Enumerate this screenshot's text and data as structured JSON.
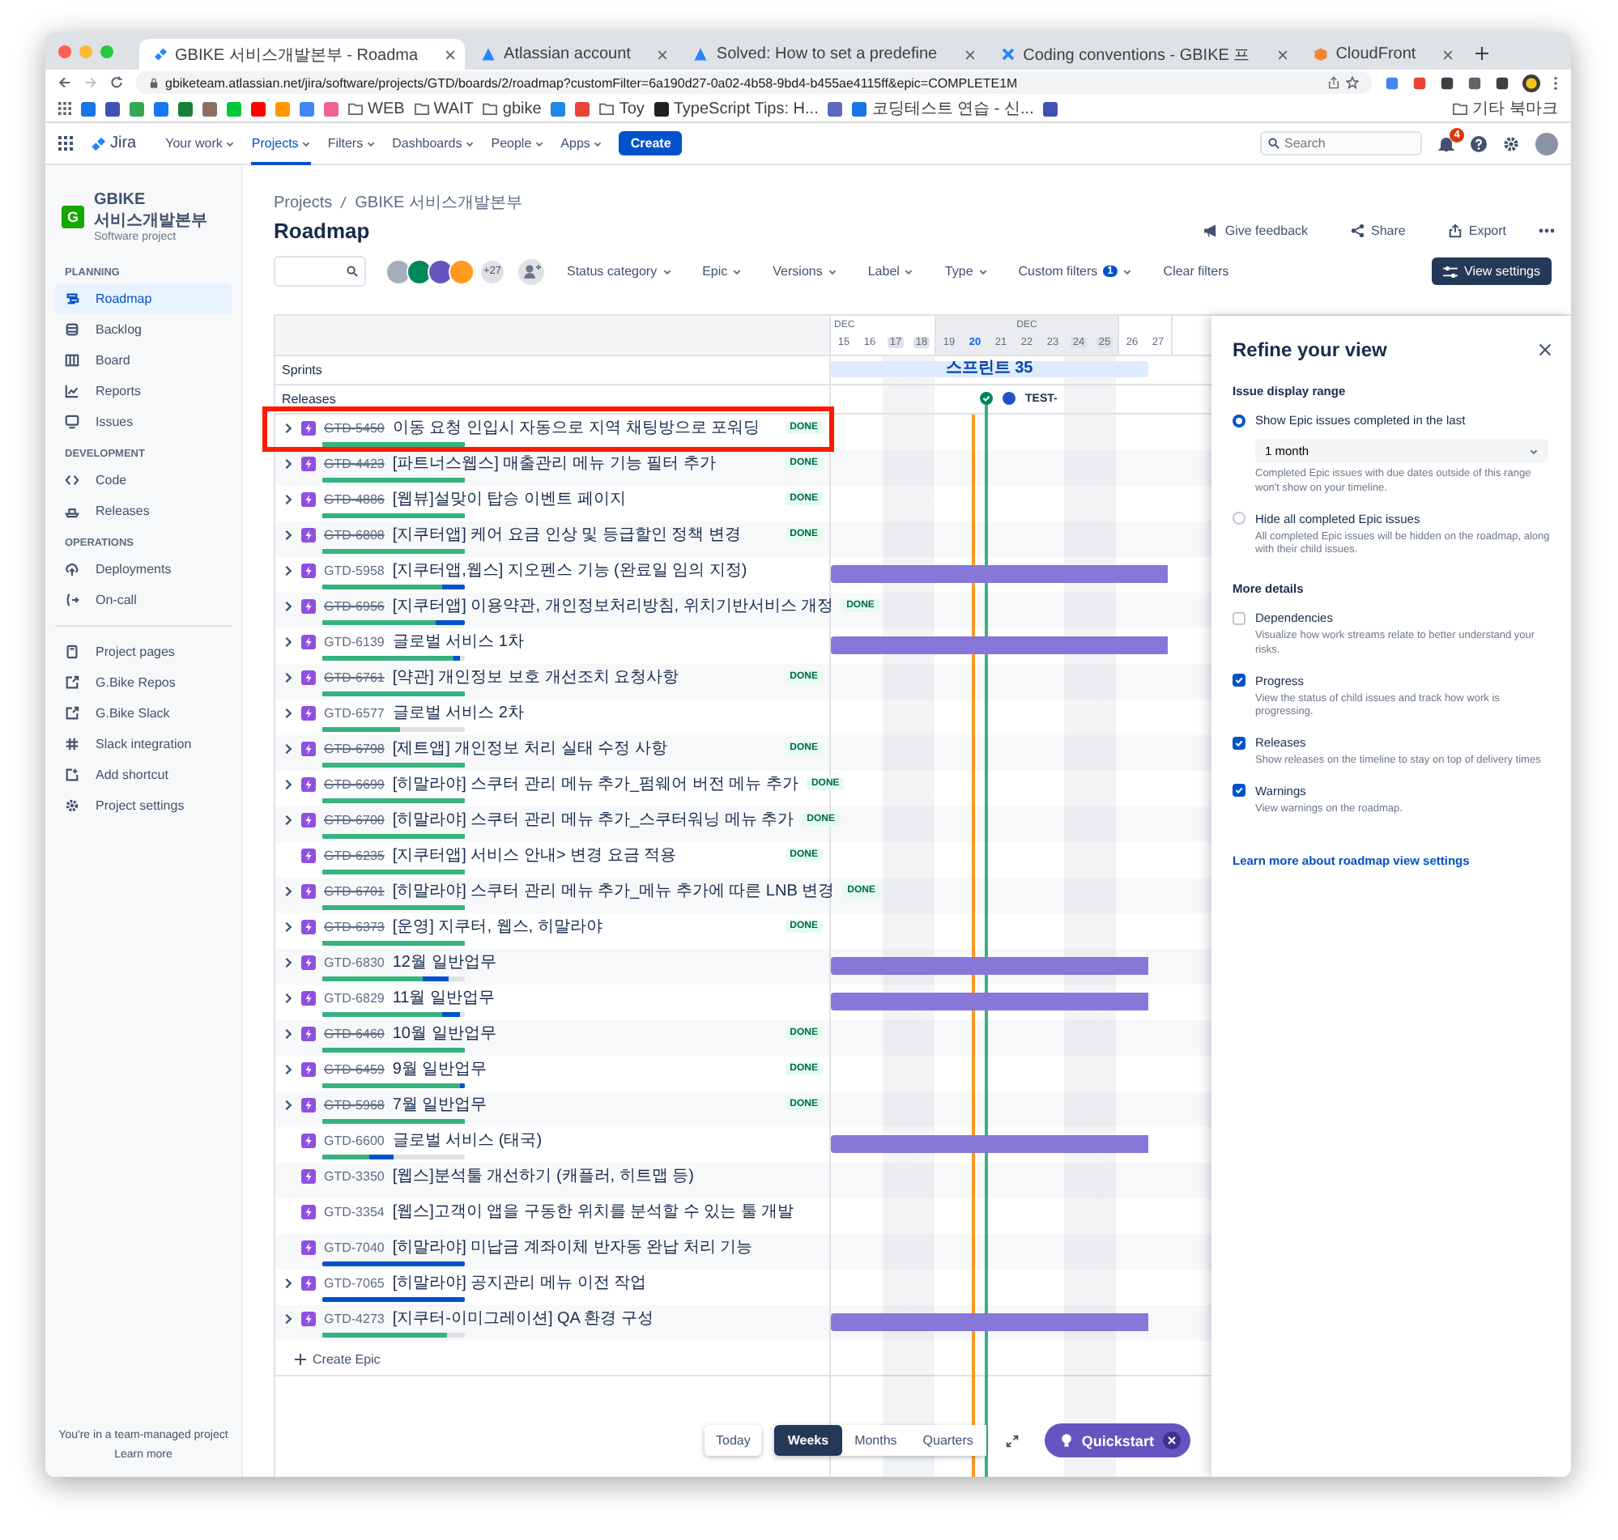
{
  "browser": {
    "tabs": [
      {
        "title": "GBIKE 서비스개발본부 - Roadma",
        "kind": "jira",
        "selected": true
      },
      {
        "title": "Atlassian account",
        "kind": "atlassian",
        "selected": false
      },
      {
        "title": "Solved: How to set a predefine",
        "kind": "atlassian",
        "selected": false
      },
      {
        "title": "Coding conventions - GBIKE 프",
        "kind": "confluence",
        "selected": false
      },
      {
        "title": "CloudFront",
        "kind": "cube",
        "selected": false
      }
    ],
    "address": "gbiketeam.atlassian.net/jira/software/projects/GTD/boards/2/roadmap?customFilter=6a190d27-0a02-4b58-9bd4-b455ae4115ff&epic=COMPLETE1M",
    "bookmarks": [
      {
        "kind": "icon"
      },
      {
        "kind": "icon"
      },
      {
        "kind": "icon"
      },
      {
        "kind": "icon"
      },
      {
        "kind": "icon"
      },
      {
        "kind": "icon"
      },
      {
        "kind": "icon"
      },
      {
        "kind": "icon"
      },
      {
        "kind": "icon"
      },
      {
        "kind": "icon"
      },
      {
        "kind": "icon"
      },
      {
        "kind": "folder",
        "label": "WEB"
      },
      {
        "kind": "folder",
        "label": "WAIT"
      },
      {
        "kind": "folder",
        "label": "gbike"
      },
      {
        "kind": "icon"
      },
      {
        "kind": "icon"
      },
      {
        "kind": "folder",
        "label": "Toy"
      },
      {
        "kind": "link",
        "label": "TypeScript Tips: H..."
      },
      {
        "kind": "icon"
      },
      {
        "kind": "link",
        "label": "코딩테스트 연습 - 신..."
      },
      {
        "kind": "icon"
      }
    ],
    "other_bookmarks": "기타 북마크"
  },
  "topnav": {
    "product": "Jira",
    "items": [
      {
        "label": "Your work",
        "selected": false
      },
      {
        "label": "Projects",
        "selected": true
      },
      {
        "label": "Filters",
        "selected": false
      },
      {
        "label": "Dashboards",
        "selected": false
      },
      {
        "label": "People",
        "selected": false
      },
      {
        "label": "Apps",
        "selected": false
      }
    ],
    "create": "Create",
    "search": {
      "placeholder": "Search"
    },
    "notifications": {
      "count": "4"
    }
  },
  "sidebar": {
    "project": {
      "logo_letter": "G",
      "name": "GBIKE 서비스개발본부",
      "type": "Software project"
    },
    "sections": [
      {
        "heading": "PLANNING",
        "items": [
          {
            "label": "Roadmap",
            "selected": true
          },
          {
            "label": "Backlog",
            "selected": false
          },
          {
            "label": "Board",
            "selected": false
          },
          {
            "label": "Reports",
            "selected": false
          },
          {
            "label": "Issues",
            "selected": false
          }
        ]
      },
      {
        "heading": "DEVELOPMENT",
        "items": [
          {
            "label": "Code",
            "selected": false
          },
          {
            "label": "Releases",
            "selected": false
          }
        ]
      },
      {
        "heading": "OPERATIONS",
        "items": [
          {
            "label": "Deployments",
            "selected": false
          },
          {
            "label": "On-call",
            "selected": false
          }
        ]
      },
      {
        "items": [
          {
            "label": "Project pages",
            "selected": false
          },
          {
            "label": "G.Bike Repos",
            "selected": false
          },
          {
            "label": "G.Bike Slack",
            "selected": false
          },
          {
            "label": "Slack integration",
            "selected": false
          },
          {
            "label": "Add shortcut",
            "selected": false
          },
          {
            "label": "Project settings",
            "selected": false
          }
        ]
      }
    ],
    "footer": {
      "text": "You're in a team-managed project",
      "link": "Learn more"
    }
  },
  "page": {
    "breadcrumbs": [
      "Projects",
      "GBIKE 서비스개발본부"
    ],
    "title": "Roadmap",
    "actions": [
      "Give feedback",
      "Share",
      "Export"
    ]
  },
  "filters": {
    "more_people": "+27",
    "dropdowns": [
      {
        "label": "Status category"
      },
      {
        "label": "Epic"
      },
      {
        "label": "Versions"
      },
      {
        "label": "Label"
      },
      {
        "label": "Type"
      },
      {
        "label": "Custom filters",
        "count": "1"
      }
    ],
    "clear": "Clear filters",
    "view_settings": "View settings"
  },
  "timeline": {
    "weeks": [
      {
        "month": "DEC",
        "current": false,
        "days": [
          {
            "label": "15",
            "weekend": false,
            "today": false
          },
          {
            "label": "16",
            "weekend": false,
            "today": false
          },
          {
            "label": "17",
            "weekend": true,
            "today": false
          },
          {
            "label": "18",
            "weekend": true,
            "today": false
          }
        ]
      },
      {
        "month": "DEC",
        "current": true,
        "days": [
          {
            "label": "19",
            "weekend": false,
            "today": false
          },
          {
            "label": "20",
            "weekend": false,
            "today": true,
            "release": {
              "name": "TEST-"
            }
          },
          {
            "label": "21",
            "weekend": false,
            "today": false
          },
          {
            "label": "22",
            "weekend": false,
            "today": false
          },
          {
            "label": "23",
            "weekend": false,
            "today": false
          },
          {
            "label": "24",
            "weekend": true,
            "today": false
          },
          {
            "label": "25",
            "weekend": true,
            "today": false
          }
        ]
      },
      {
        "current": false,
        "days": [
          {
            "label": "26",
            "weekend": false,
            "today": false
          },
          {
            "label": "27",
            "weekend": false,
            "today": false
          }
        ]
      }
    ],
    "sprints_label": "Sprints",
    "sprints": [
      {
        "name": "스프린트 35",
        "level": 0.94
      }
    ],
    "releases_label": "Releases",
    "epics": [
      {
        "key": "GTD-5450",
        "title": "이동 요청 인입시 자동으로 지역 채팅방으로 포워딩",
        "done": true,
        "status": "DONE",
        "expandable": true,
        "highlighted": true,
        "progress": {
          "done": {
            "level": 1
          },
          "started": {
            "level": 1
          }
        }
      },
      {
        "key": "GTD-4423",
        "title": "[파트너스웹스] 매출관리 메뉴 기능 필터 추가",
        "done": true,
        "status": "DONE",
        "expandable": true,
        "highlighted": false,
        "progress": {
          "done": {
            "level": 1
          },
          "started": {
            "level": 1
          }
        }
      },
      {
        "key": "GTD-4886",
        "title": "[웹뷰]설맞이 탑승 이벤트 페이지",
        "done": true,
        "status": "DONE",
        "expandable": true,
        "highlighted": false,
        "progress": {
          "done": {
            "level": 1
          },
          "started": {
            "level": 1
          }
        }
      },
      {
        "key": "GTD-6808",
        "title": "[지쿠터앱] 케어 요금 인상 및 등급할인 정책 변경",
        "done": true,
        "status": "DONE",
        "expandable": true,
        "highlighted": false,
        "progress": {
          "done": {
            "level": 1
          },
          "started": {
            "level": 1
          }
        }
      },
      {
        "key": "GTD-5958",
        "title": "[지쿠터앱,웹스] 지오펜스 기능 (완료일 임의 지정)",
        "done": false,
        "expandable": true,
        "highlighted": false,
        "progress": {
          "done": {
            "level": 0.84
          },
          "started": {
            "level": 1
          }
        },
        "timeline_bar": {
          "level": 1
        }
      },
      {
        "key": "GTD-6956",
        "title": "[지쿠터앱] 이용약관, 개인정보처리방침, 위치기반서비스 개정",
        "done": true,
        "status": "DONE",
        "expandable": true,
        "highlighted": false,
        "progress": {
          "done": {
            "level": 0.8
          },
          "started": {
            "level": 1
          }
        }
      },
      {
        "key": "GTD-6139",
        "title": "글로벌 서비스 1차",
        "done": false,
        "expandable": true,
        "highlighted": false,
        "progress": {
          "done": {
            "level": 0.92
          },
          "started": {
            "level": 0.97
          }
        },
        "timeline_bar": {
          "level": 1
        }
      },
      {
        "key": "GTD-6761",
        "title": "[약관] 개인정보 보호 개선조치 요청사항",
        "done": true,
        "status": "DONE",
        "expandable": true,
        "highlighted": false,
        "progress": {
          "done": {
            "level": 1
          },
          "started": {
            "level": 1
          }
        }
      },
      {
        "key": "GTD-6577",
        "title": "글로벌 서비스 2차",
        "done": false,
        "expandable": true,
        "highlighted": false,
        "progress": {
          "done": {
            "level": 0.55
          },
          "started": {
            "level": 0.55
          }
        }
      },
      {
        "key": "GTD-6798",
        "title": "[제트앱] 개인정보 처리 실태 수정 사항",
        "done": true,
        "status": "DONE",
        "expandable": true,
        "highlighted": false,
        "progress": {
          "done": {
            "level": 1
          },
          "started": {
            "level": 1
          }
        }
      },
      {
        "key": "GTD-6699",
        "title": "[히말라야] 스쿠터 관리 메뉴 추가_펌웨어 버전 메뉴 추가",
        "done": true,
        "status": "DONE",
        "expandable": true,
        "highlighted": false,
        "progress": {
          "done": {
            "level": 1
          },
          "started": {
            "level": 1
          }
        }
      },
      {
        "key": "GTD-6700",
        "title": "[히말라야] 스쿠터 관리 메뉴 추가_스쿠터워닝 메뉴 추가",
        "done": true,
        "status": "DONE",
        "expandable": true,
        "highlighted": false,
        "progress": {
          "done": {
            "level": 1
          },
          "started": {
            "level": 1
          }
        }
      },
      {
        "key": "GTD-6235",
        "title": "[지쿠터앱] 서비스 안내> 변경 요금 적용",
        "done": true,
        "status": "DONE",
        "expandable": false,
        "highlighted": false,
        "progress": {
          "done": {
            "level": 1
          },
          "started": {
            "level": 1
          }
        }
      },
      {
        "key": "GTD-6701",
        "title": "[히말라야] 스쿠터 관리 메뉴 추가_메뉴 추가에 따른 LNB 변경",
        "done": true,
        "status": "DONE",
        "expandable": true,
        "highlighted": false,
        "progress": {
          "done": {
            "level": 1
          },
          "started": {
            "level": 1
          }
        }
      },
      {
        "key": "GTD-6373",
        "title": "[운영] 지쿠터, 웹스, 히말라야",
        "done": true,
        "status": "DONE",
        "expandable": true,
        "highlighted": false,
        "progress": {
          "done": {
            "level": 1
          },
          "started": {
            "level": 1
          }
        }
      },
      {
        "key": "GTD-6830",
        "title": "12월 일반업무",
        "done": false,
        "expandable": true,
        "highlighted": false,
        "progress": {
          "done": {
            "level": 0.71
          },
          "started": {
            "level": 0.89
          }
        },
        "timeline_bar": {
          "level": 0.94
        }
      },
      {
        "key": "GTD-6829",
        "title": "11월 일반업무",
        "done": false,
        "expandable": true,
        "highlighted": false,
        "progress": {
          "done": {
            "level": 0.84
          },
          "started": {
            "level": 0.97
          }
        },
        "timeline_bar": {
          "level": 0.94
        }
      },
      {
        "key": "GTD-6460",
        "title": "10월 일반업무",
        "done": true,
        "status": "DONE",
        "expandable": true,
        "highlighted": false,
        "progress": {
          "done": {
            "level": 1
          },
          "started": {
            "level": 1
          }
        }
      },
      {
        "key": "GTD-6459",
        "title": "9월 일반업무",
        "done": true,
        "status": "DONE",
        "expandable": true,
        "highlighted": false,
        "progress": {
          "done": {
            "level": 0.97
          },
          "started": {
            "level": 1
          }
        }
      },
      {
        "key": "GTD-5968",
        "title": "7월 일반업무",
        "done": true,
        "status": "DONE",
        "expandable": true,
        "highlighted": false,
        "progress": {
          "done": {
            "level": 1
          },
          "started": {
            "level": 1
          }
        }
      },
      {
        "key": "GTD-6600",
        "title": "글로벌 서비스 (태국)",
        "done": false,
        "expandable": false,
        "highlighted": false,
        "progress": {
          "done": {
            "level": 0.33
          },
          "started": {
            "level": 0.5
          }
        },
        "timeline_bar": {
          "level": 0.94
        }
      },
      {
        "key": "GTD-3350",
        "title": "[웹스]분석툴 개선하기 (캐플러, 히트맵 등)",
        "done": false,
        "expandable": false,
        "highlighted": false
      },
      {
        "key": "GTD-3354",
        "title": "[웹스]고객이 앱을 구동한 위치를 분석할 수 있는 툴 개발",
        "done": false,
        "expandable": false,
        "highlighted": false
      },
      {
        "key": "GTD-7040",
        "title": "[히말라야] 미납금 계좌이체 반자동 완납 처리 기능",
        "done": false,
        "expandable": false,
        "highlighted": false,
        "progress": {
          "done": {
            "level": 0
          },
          "started": {
            "level": 1
          }
        }
      },
      {
        "key": "GTD-7065",
        "title": "[히말라야] 공지관리 메뉴 이전 작업",
        "done": false,
        "expandable": true,
        "highlighted": false,
        "progress": {
          "done": {
            "level": 0
          },
          "started": {
            "level": 1
          }
        }
      },
      {
        "key": "GTD-4273",
        "title": "[지쿠터-이미그레이션] QA 환경 구성",
        "done": false,
        "expandable": true,
        "highlighted": false,
        "progress": {
          "done": {
            "level": 0.87
          },
          "started": {
            "level": 0.87
          }
        },
        "timeline_bar": {
          "level": 0.94
        }
      }
    ],
    "create_epic": "Create Epic"
  },
  "zoom": {
    "today": "Today",
    "scales": [
      {
        "label": "Weeks",
        "selected": true
      },
      {
        "label": "Months",
        "selected": false
      },
      {
        "label": "Quarters",
        "selected": false
      }
    ]
  },
  "quickstart": "Quickstart",
  "panel": {
    "title": "Refine your view",
    "range_heading": "Issue display range",
    "range_options": [
      {
        "label": "Show Epic issues completed in the last",
        "selected": true,
        "select": {
          "value": "1 month"
        },
        "description": "Completed Epic issues with due dates outside of this range won't show on your timeline."
      },
      {
        "label": "Hide all completed Epic issues",
        "selected": false,
        "description": "All completed Epic issues will be hidden on the roadmap, along with their child issues."
      }
    ],
    "details_heading": "More details",
    "details": [
      {
        "label": "Dependencies",
        "checked": false,
        "description": "Visualize how work streams relate to better understand your risks."
      },
      {
        "label": "Progress",
        "checked": true,
        "description": "View the status of child issues and track how work is progressing."
      },
      {
        "label": "Releases",
        "checked": true,
        "description": "Show releases on the timeline to stay on top of delivery times"
      },
      {
        "label": "Warnings",
        "checked": true,
        "description": "View warnings on the roadmap."
      }
    ],
    "link": "Learn more about roadmap view settings"
  }
}
